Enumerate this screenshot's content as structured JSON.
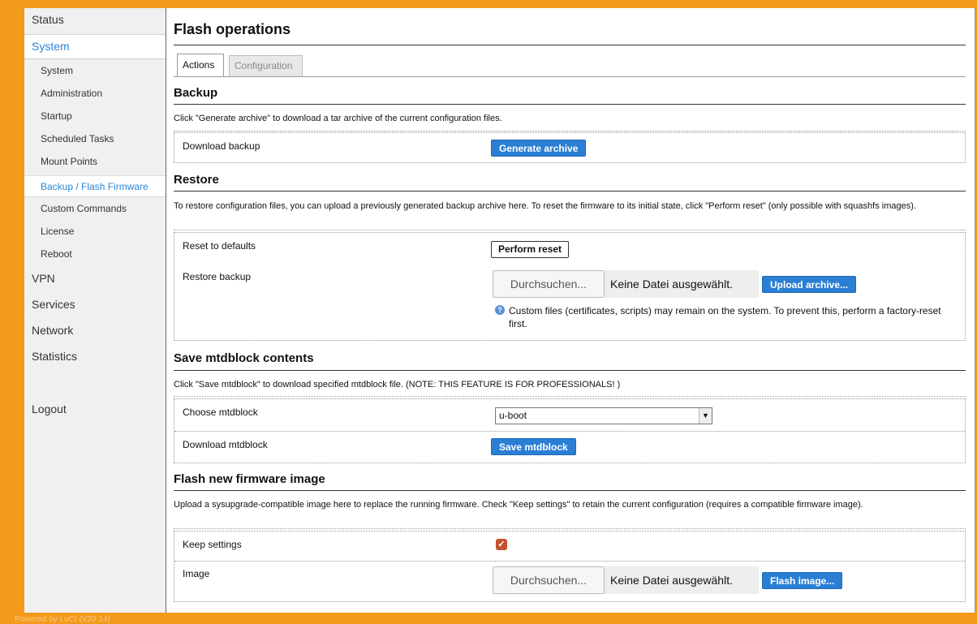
{
  "sidebar": {
    "status": "Status",
    "system": "System",
    "sub": [
      "System",
      "Administration",
      "Startup",
      "Scheduled Tasks",
      "Mount Points",
      "Backup / Flash Firmware",
      "Custom Commands",
      "License",
      "Reboot"
    ],
    "vpn": "VPN",
    "services": "Services",
    "network": "Network",
    "statistics": "Statistics",
    "logout": "Logout"
  },
  "footer": "Powered by LuCI (V20.14)",
  "page": {
    "title": "Flash operations",
    "tabs": [
      "Actions",
      "Configuration"
    ]
  },
  "backup": {
    "title": "Backup",
    "desc": "Click \"Generate archive\" to download a tar archive of the current configuration files.",
    "download_label": "Download backup",
    "generate_button": "Generate archive"
  },
  "restore": {
    "title": "Restore",
    "desc": "To restore configuration files, you can upload a previously generated backup archive here. To reset the firmware to its initial state, click \"Perform reset\" (only possible with squashfs images).",
    "reset_label": "Reset to defaults",
    "reset_button": "Perform reset",
    "restore_label": "Restore backup",
    "browse_button": "Durchsuchen...",
    "no_file": "Keine Datei ausgewählt.",
    "upload_button": "Upload archive...",
    "hint": "Custom files (certificates, scripts) may remain on the system. To prevent this, perform a factory-reset first."
  },
  "mtd": {
    "title": "Save mtdblock contents",
    "desc": "Click \"Save mtdblock\" to download specified mtdblock file. (NOTE: THIS FEATURE IS FOR PROFESSIONALS! )",
    "choose_label": "Choose mtdblock",
    "selected": "u-boot",
    "download_label": "Download mtdblock",
    "save_button": "Save mtdblock"
  },
  "flash": {
    "title": "Flash new firmware image",
    "desc": "Upload a sysupgrade-compatible image here to replace the running firmware. Check \"Keep settings\" to retain the current configuration (requires a compatible firmware image).",
    "keep_label": "Keep settings",
    "keep_checked": true,
    "image_label": "Image",
    "browse_button": "Durchsuchen...",
    "no_file": "Keine Datei ausgewählt.",
    "flash_button": "Flash image..."
  },
  "colors": {
    "frame": "#f29a1a",
    "accent": "#2a7fd4",
    "checkbox": "#c5512f"
  }
}
